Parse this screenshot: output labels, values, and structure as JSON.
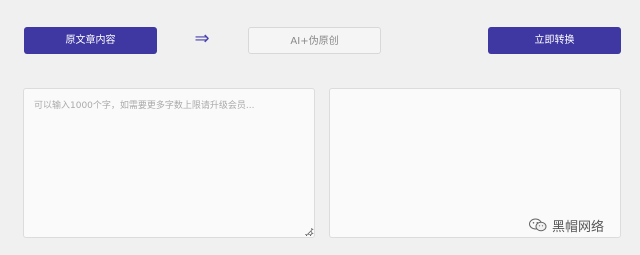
{
  "toolbar": {
    "source_label": "原文章内容",
    "arrow_icon": "double-right-arrow-icon",
    "mode_label": "AI+伪原创",
    "convert_label": "立即转换"
  },
  "input": {
    "placeholder": "可以输入1000个字，如需要更多字数上限请升级会员..."
  },
  "output": {
    "value": ""
  },
  "watermark": {
    "text": "黑帽网络",
    "icon": "wechat-icon"
  },
  "colors": {
    "accent": "#3f37a2",
    "background": "#f0f0f0"
  }
}
